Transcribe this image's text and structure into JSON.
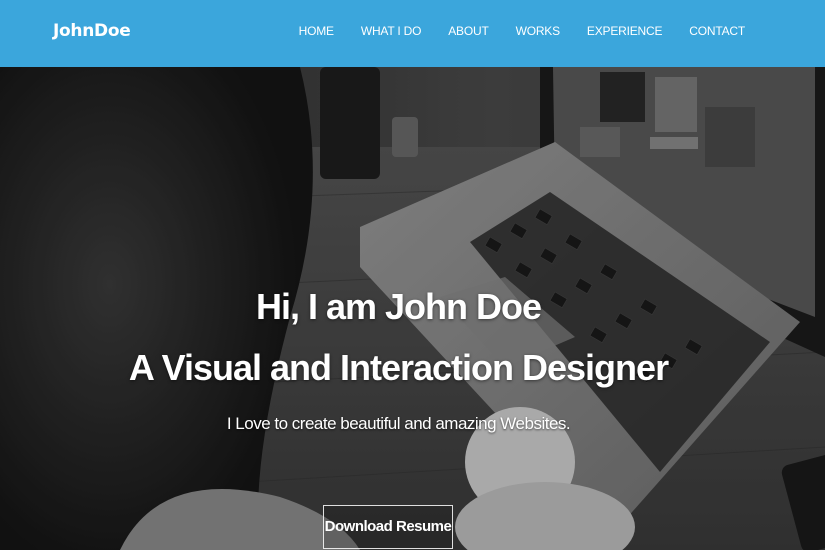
{
  "brand": "JohnDoe",
  "nav": {
    "items": [
      "HOME",
      "WHAT I DO",
      "ABOUT",
      "WORKS",
      "EXPERIENCE",
      "CONTACT"
    ]
  },
  "hero": {
    "greeting": "Hi, I am John Doe",
    "role": "A Visual and Interaction Designer",
    "tagline": "I Love to create beautiful and amazing Websites.",
    "button_label": "Download Resume",
    "background_image": "grayscale-laptop-workspace-photo"
  },
  "colors": {
    "navbar": "#3ba6dc",
    "text": "#ffffff"
  }
}
